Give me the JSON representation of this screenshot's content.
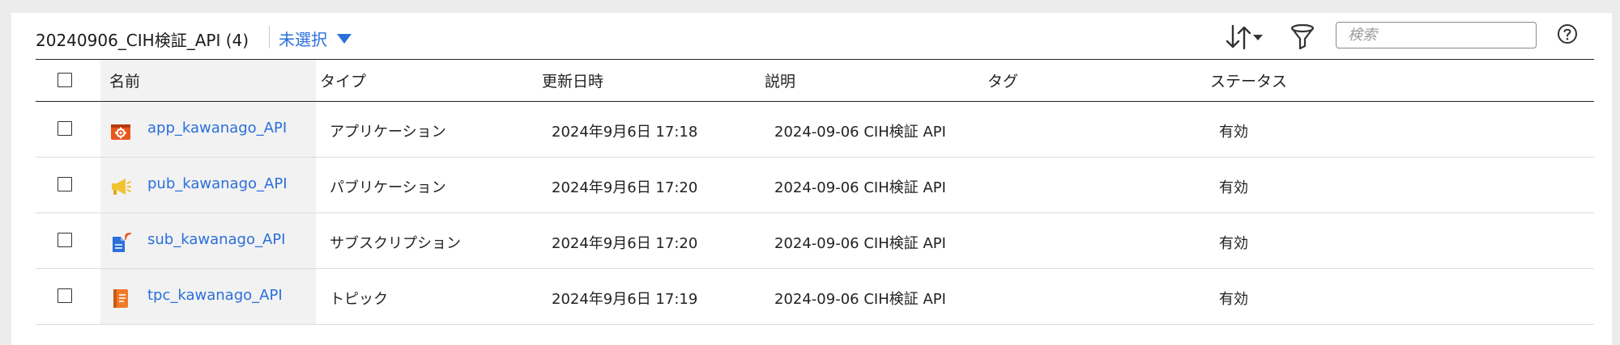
{
  "toolbar": {
    "folder_title": "20240906_CIH検証_API (4)",
    "selection_label": "未選択",
    "search_placeholder": "検索"
  },
  "colors": {
    "accent": "#2a6fdb",
    "app_icon": "#e8561c",
    "pub_icon": "#f2c230",
    "sub_icon": "#2a6fdb",
    "topic_icon": "#f07a2a"
  },
  "table": {
    "columns": {
      "name": "名前",
      "type": "タイプ",
      "updated": "更新日時",
      "description": "説明",
      "tags": "タグ",
      "status": "ステータス"
    },
    "rows": [
      {
        "icon": "application-icon",
        "name": "app_kawanago_API",
        "type": "アプリケーション",
        "updated": "2024年9月6日 17:18",
        "description": "2024-09-06 CIH検証 API",
        "tags": "",
        "status": "有効"
      },
      {
        "icon": "publication-icon",
        "name": "pub_kawanago_API",
        "type": "パブリケーション",
        "updated": "2024年9月6日 17:20",
        "description": "2024-09-06 CIH検証 API",
        "tags": "",
        "status": "有効"
      },
      {
        "icon": "subscription-icon",
        "name": "sub_kawanago_API",
        "type": "サブスクリプション",
        "updated": "2024年9月6日 17:20",
        "description": "2024-09-06 CIH検証 API",
        "tags": "",
        "status": "有効"
      },
      {
        "icon": "topic-icon",
        "name": "tpc_kawanago_API",
        "type": "トピック",
        "updated": "2024年9月6日 17:19",
        "description": "2024-09-06 CIH検証 API",
        "tags": "",
        "status": "有効"
      }
    ]
  }
}
